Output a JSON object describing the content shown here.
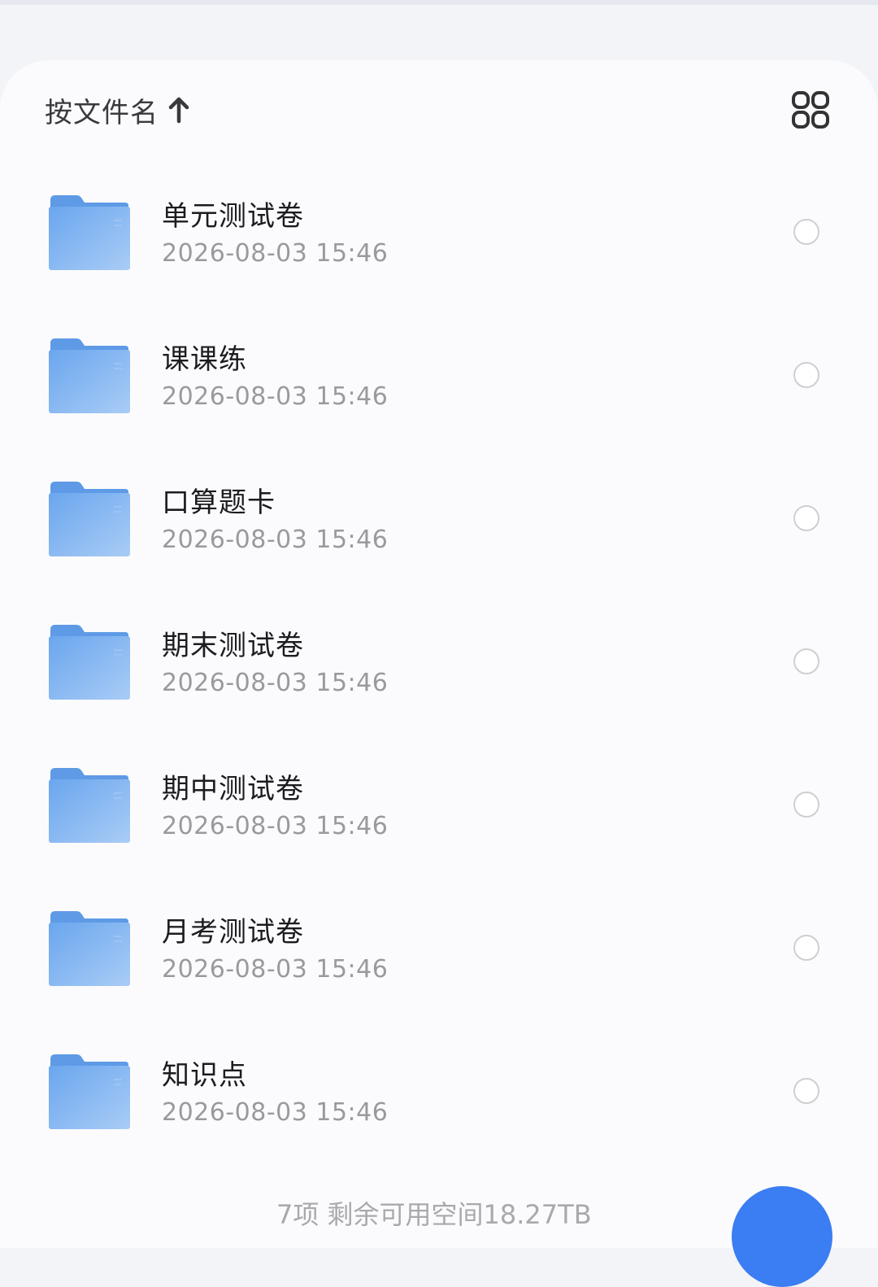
{
  "sort": {
    "label": "按文件名",
    "direction_icon": "arrow-up-icon"
  },
  "view_toggle_icon": "grid-view-icon",
  "files": [
    {
      "name": "单元测试卷",
      "date": "2026-08-03 15:46"
    },
    {
      "name": "课课练",
      "date": "2026-08-03 15:46"
    },
    {
      "name": "口算题卡",
      "date": "2026-08-03 15:46"
    },
    {
      "name": "期末测试卷",
      "date": "2026-08-03 15:46"
    },
    {
      "name": "期中测试卷",
      "date": "2026-08-03 15:46"
    },
    {
      "name": "月考测试卷",
      "date": "2026-08-03 15:46"
    },
    {
      "name": "知识点",
      "date": "2026-08-03 15:46"
    }
  ],
  "footer": {
    "summary": "7项 剩余可用空间18.27TB"
  },
  "colors": {
    "accent": "#3b7df2",
    "folder": "#7fb2ef",
    "folder_tab": "#5e9ae6"
  }
}
